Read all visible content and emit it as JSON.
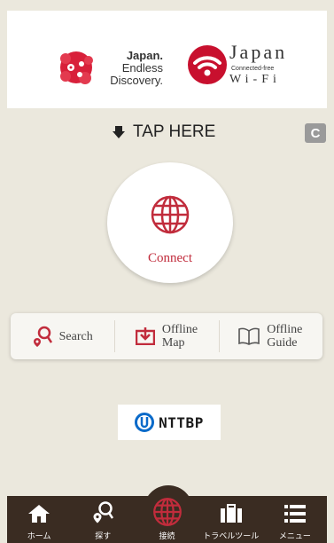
{
  "header": {
    "logo_japan_bold": "Japan.",
    "logo_japan_l2": "Endless",
    "logo_japan_l3": "Discovery.",
    "logo_wifi_title": "Japan",
    "logo_wifi_sub": "Connected-free",
    "logo_wifi_name": "Wi-Fi"
  },
  "main": {
    "tap_label": "TAP HERE",
    "connect_label": "Connect"
  },
  "toolbar": {
    "search_label": "Search",
    "offline_map_l1": "Offline",
    "offline_map_l2": "Map",
    "offline_guide_l1": "Offline",
    "offline_guide_l2": "Guide"
  },
  "footer": {
    "sponsor": "NTTBP"
  },
  "tabbar": {
    "tabs": [
      {
        "label": "ホーム",
        "icon": "home-icon"
      },
      {
        "label": "探す",
        "icon": "search-pin-icon"
      },
      {
        "label": "接続",
        "icon": "globe-icon"
      },
      {
        "label": "トラベルツール",
        "icon": "suitcase-icon"
      },
      {
        "label": "メニュー",
        "icon": "menu-icon"
      }
    ]
  },
  "colors": {
    "accent": "#c12c3c",
    "background": "#ebe8dd",
    "tabbar": "#3a2c22"
  }
}
